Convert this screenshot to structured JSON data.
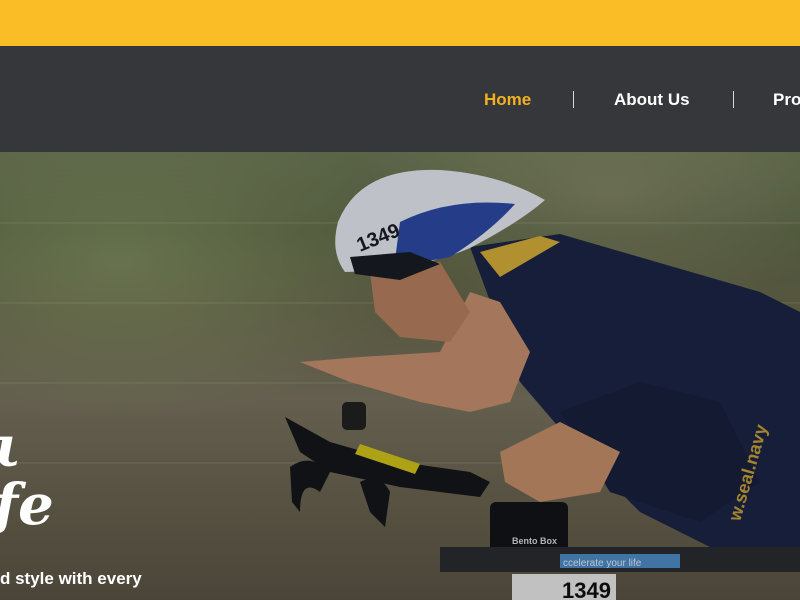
{
  "nav": {
    "items": [
      {
        "label": "Home",
        "active": true
      },
      {
        "label": "About Us",
        "active": false
      },
      {
        "label": "Pro",
        "active": false
      }
    ]
  },
  "hero": {
    "script_lines": [
      "ι",
      "fe"
    ],
    "tagline": "d style with every",
    "helmet_number": "1349",
    "bib_number": "1349",
    "bag_text": "Bento Box",
    "jersey_text": "w.seal.navy",
    "tube_text": "ccelerate your life"
  },
  "colors": {
    "accent": "#fbbd26",
    "nav_bg": "#36373b",
    "active_link": "#f2b21f"
  }
}
